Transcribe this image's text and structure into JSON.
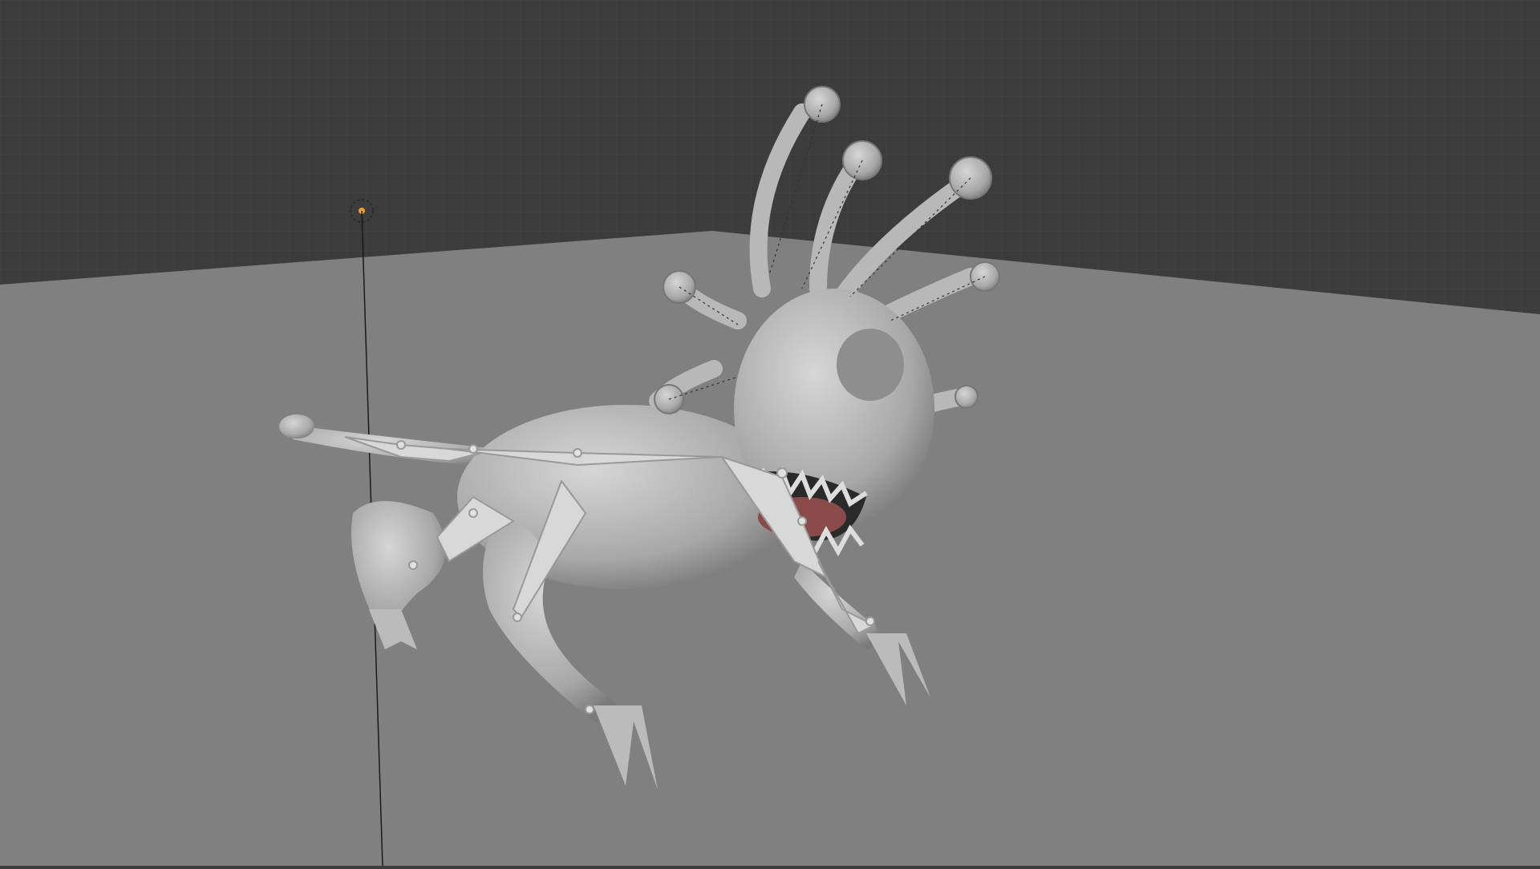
{
  "viewport": {
    "colors": {
      "background": "#3c3c3c",
      "grid": "#444444",
      "ground": "#808080",
      "mesh": "#c4c4c4",
      "mesh_shadow": "#8e8e8e",
      "mouth": "#8a4a4a",
      "light": "#e8a030"
    },
    "objects": [
      "light-icon",
      "ground-plane",
      "creature-mesh",
      "armature"
    ]
  }
}
